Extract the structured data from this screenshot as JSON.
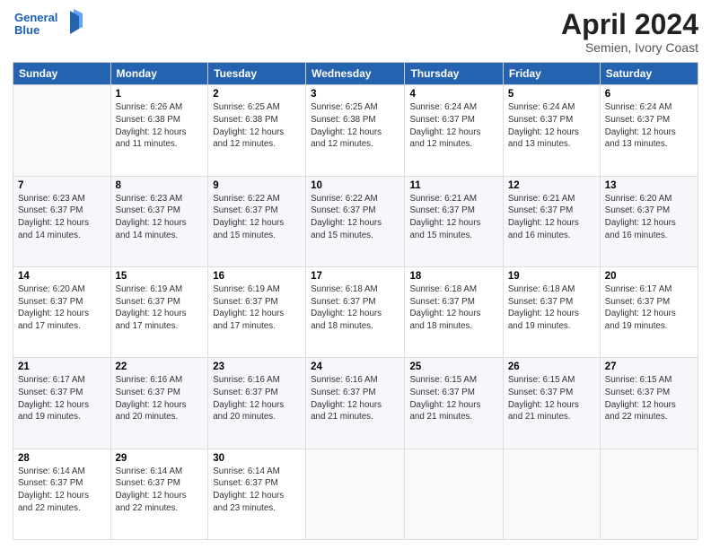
{
  "header": {
    "logo_line1": "General",
    "logo_line2": "Blue",
    "month_title": "April 2024",
    "subtitle": "Semien, Ivory Coast"
  },
  "weekdays": [
    "Sunday",
    "Monday",
    "Tuesday",
    "Wednesday",
    "Thursday",
    "Friday",
    "Saturday"
  ],
  "weeks": [
    [
      {
        "day": "",
        "info": ""
      },
      {
        "day": "1",
        "info": "Sunrise: 6:26 AM\nSunset: 6:38 PM\nDaylight: 12 hours\nand 11 minutes."
      },
      {
        "day": "2",
        "info": "Sunrise: 6:25 AM\nSunset: 6:38 PM\nDaylight: 12 hours\nand 12 minutes."
      },
      {
        "day": "3",
        "info": "Sunrise: 6:25 AM\nSunset: 6:38 PM\nDaylight: 12 hours\nand 12 minutes."
      },
      {
        "day": "4",
        "info": "Sunrise: 6:24 AM\nSunset: 6:37 PM\nDaylight: 12 hours\nand 12 minutes."
      },
      {
        "day": "5",
        "info": "Sunrise: 6:24 AM\nSunset: 6:37 PM\nDaylight: 12 hours\nand 13 minutes."
      },
      {
        "day": "6",
        "info": "Sunrise: 6:24 AM\nSunset: 6:37 PM\nDaylight: 12 hours\nand 13 minutes."
      }
    ],
    [
      {
        "day": "7",
        "info": "Sunrise: 6:23 AM\nSunset: 6:37 PM\nDaylight: 12 hours\nand 14 minutes."
      },
      {
        "day": "8",
        "info": "Sunrise: 6:23 AM\nSunset: 6:37 PM\nDaylight: 12 hours\nand 14 minutes."
      },
      {
        "day": "9",
        "info": "Sunrise: 6:22 AM\nSunset: 6:37 PM\nDaylight: 12 hours\nand 15 minutes."
      },
      {
        "day": "10",
        "info": "Sunrise: 6:22 AM\nSunset: 6:37 PM\nDaylight: 12 hours\nand 15 minutes."
      },
      {
        "day": "11",
        "info": "Sunrise: 6:21 AM\nSunset: 6:37 PM\nDaylight: 12 hours\nand 15 minutes."
      },
      {
        "day": "12",
        "info": "Sunrise: 6:21 AM\nSunset: 6:37 PM\nDaylight: 12 hours\nand 16 minutes."
      },
      {
        "day": "13",
        "info": "Sunrise: 6:20 AM\nSunset: 6:37 PM\nDaylight: 12 hours\nand 16 minutes."
      }
    ],
    [
      {
        "day": "14",
        "info": "Sunrise: 6:20 AM\nSunset: 6:37 PM\nDaylight: 12 hours\nand 17 minutes."
      },
      {
        "day": "15",
        "info": "Sunrise: 6:19 AM\nSunset: 6:37 PM\nDaylight: 12 hours\nand 17 minutes."
      },
      {
        "day": "16",
        "info": "Sunrise: 6:19 AM\nSunset: 6:37 PM\nDaylight: 12 hours\nand 17 minutes."
      },
      {
        "day": "17",
        "info": "Sunrise: 6:18 AM\nSunset: 6:37 PM\nDaylight: 12 hours\nand 18 minutes."
      },
      {
        "day": "18",
        "info": "Sunrise: 6:18 AM\nSunset: 6:37 PM\nDaylight: 12 hours\nand 18 minutes."
      },
      {
        "day": "19",
        "info": "Sunrise: 6:18 AM\nSunset: 6:37 PM\nDaylight: 12 hours\nand 19 minutes."
      },
      {
        "day": "20",
        "info": "Sunrise: 6:17 AM\nSunset: 6:37 PM\nDaylight: 12 hours\nand 19 minutes."
      }
    ],
    [
      {
        "day": "21",
        "info": "Sunrise: 6:17 AM\nSunset: 6:37 PM\nDaylight: 12 hours\nand 19 minutes."
      },
      {
        "day": "22",
        "info": "Sunrise: 6:16 AM\nSunset: 6:37 PM\nDaylight: 12 hours\nand 20 minutes."
      },
      {
        "day": "23",
        "info": "Sunrise: 6:16 AM\nSunset: 6:37 PM\nDaylight: 12 hours\nand 20 minutes."
      },
      {
        "day": "24",
        "info": "Sunrise: 6:16 AM\nSunset: 6:37 PM\nDaylight: 12 hours\nand 21 minutes."
      },
      {
        "day": "25",
        "info": "Sunrise: 6:15 AM\nSunset: 6:37 PM\nDaylight: 12 hours\nand 21 minutes."
      },
      {
        "day": "26",
        "info": "Sunrise: 6:15 AM\nSunset: 6:37 PM\nDaylight: 12 hours\nand 21 minutes."
      },
      {
        "day": "27",
        "info": "Sunrise: 6:15 AM\nSunset: 6:37 PM\nDaylight: 12 hours\nand 22 minutes."
      }
    ],
    [
      {
        "day": "28",
        "info": "Sunrise: 6:14 AM\nSunset: 6:37 PM\nDaylight: 12 hours\nand 22 minutes."
      },
      {
        "day": "29",
        "info": "Sunrise: 6:14 AM\nSunset: 6:37 PM\nDaylight: 12 hours\nand 22 minutes."
      },
      {
        "day": "30",
        "info": "Sunrise: 6:14 AM\nSunset: 6:37 PM\nDaylight: 12 hours\nand 23 minutes."
      },
      {
        "day": "",
        "info": ""
      },
      {
        "day": "",
        "info": ""
      },
      {
        "day": "",
        "info": ""
      },
      {
        "day": "",
        "info": ""
      }
    ]
  ]
}
